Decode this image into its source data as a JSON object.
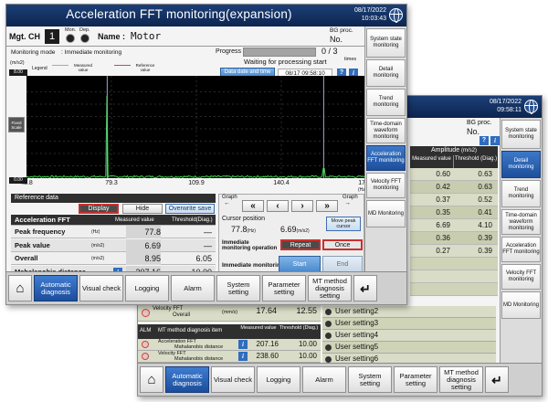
{
  "colors": {
    "title_bg": "#16376b",
    "accent_blue": "#2b64b8",
    "spectrum_line": "#3cd64a",
    "marker_line": "#9aa8d8",
    "reference_line": "#d9414a",
    "olive_row": "#d9dcc6"
  },
  "back": {
    "datetime": [
      "08/17/2022",
      "09:58:11"
    ],
    "bg_proc_label": "BG proc.",
    "no_label": "No.",
    "amplitude_header": "Amplitude",
    "amplitude_unit": "(m/s2)",
    "measured_header": "Measured value",
    "threshold_header": "Threshold (Diag.)",
    "rows": [
      {
        "measured": "0.60",
        "threshold": "0.63"
      },
      {
        "measured": "0.42",
        "threshold": "0.63"
      },
      {
        "measured": "0.37",
        "threshold": "0.52"
      },
      {
        "measured": "0.35",
        "threshold": "0.41"
      },
      {
        "measured": "6.69",
        "threshold": "4.10"
      },
      {
        "measured": "0.36",
        "threshold": "0.39"
      },
      {
        "measured": "0.27",
        "threshold": "0.39"
      }
    ],
    "velocity_row": {
      "label1": "Velocity FFT",
      "label2": "Overall",
      "unit": "(mm/s)",
      "measured": "17.64",
      "threshold": "12.55"
    },
    "mt_table": {
      "al_m": "ALM",
      "item_header": "MT method diagnosis item",
      "measured_header": "Measured value",
      "threshold_header": "Threshold (Diag.)",
      "rows": [
        {
          "label1": "Acceleration FFT",
          "label2": "Mahalanobis distance",
          "measured": "207.16",
          "threshold": "10.00"
        },
        {
          "label1": "Velocity FFT",
          "label2": "Mahalanobis distance",
          "measured": "238.60",
          "threshold": "10.00"
        }
      ]
    },
    "user_settings": [
      "User setting2",
      "User setting3",
      "User setting4",
      "User setting5",
      "User setting6"
    ],
    "side_buttons": [
      "System state monitoring",
      "Detail monitoring",
      "Trend monitoring",
      "Time-domain waveform monitoring",
      "Acceleration FFT monitoring",
      "Velocity FFT monitoring",
      "MD Monitoring"
    ],
    "side_active": 1,
    "bottom_buttons": [
      "Automatic diagnosis",
      "Visual check",
      "Logging",
      "Alarm",
      "System setting",
      "Parameter setting",
      "MT method diagnosis setting"
    ]
  },
  "front": {
    "title": "Acceleration FFT monitoring(expansion)",
    "datetime": [
      "08/17/2022",
      "10:03:43"
    ],
    "mgt_ch_label": "Mgt. CH",
    "mgt_ch_value": "1",
    "mon_label": "Mon.",
    "dep_label": "Dep.",
    "name_label": "Name :",
    "name_value": "Motor",
    "bg_proc_label": "BG proc.",
    "no_label": "No.",
    "monitoring_mode_label": "Monitoring mode",
    "monitoring_mode_value": ": Immediate monitoring",
    "progress_label": "Progress",
    "progress_value": "0",
    "progress_total": "3",
    "times_label": "times",
    "waiting_text": "Waiting for processing start",
    "data_date_label": "Data date and time",
    "data_date_value": "08/17 09:58:10",
    "unit_label": "(m/s2)",
    "legend_label": "Legend",
    "legend_measured": "Measured value",
    "legend_reference": "Reference value",
    "y_top": "8.00",
    "y_bottom": "0.00",
    "hz_label": "(Hz)",
    "fixed_scale": "Fixed Scale",
    "chart_data": {
      "type": "line",
      "x_ticks": [
        "48.8",
        "79.3",
        "109.9",
        "140.4",
        "170.9"
      ],
      "ylim": [
        0,
        8
      ],
      "xlim": [
        48.8,
        170.9
      ],
      "peaks": [
        {
          "x": 77.8,
          "y": 6.69
        },
        {
          "x": 155.6,
          "y": 0.78
        }
      ]
    },
    "reference_title": "Reference data",
    "display_btn": "Display",
    "hide_btn": "Hide",
    "overwrite_btn": "Overwrite save",
    "table_header": {
      "item": "Acceleration FFT",
      "measured": "Measured value",
      "threshold": "Threshold(Diag.)"
    },
    "rows": [
      {
        "label": "Peak frequency",
        "unit": "(Hz)",
        "measured": "77.8",
        "threshold": "—"
      },
      {
        "label": "Peak value",
        "unit": "(m/s2)",
        "measured": "6.69",
        "threshold": "—"
      },
      {
        "label": "Overall",
        "unit": "(m/s2)",
        "measured": "8.95",
        "threshold": "6.05"
      },
      {
        "label": "Mahalanobis distance",
        "unit": "",
        "measured": "207.16",
        "threshold": "10.00"
      }
    ],
    "graph_left_label": "Graph",
    "graph_right_label": "Graph",
    "nav_buttons": [
      "«",
      "‹",
      "›",
      "»"
    ],
    "cursor_position_label": "Cursor position",
    "cursor_freq": "77.8",
    "cursor_freq_unit": "(Hz)",
    "cursor_amp": "6.69",
    "cursor_amp_unit": "(m/s2)",
    "move_peak_btn": "Move peak cursor",
    "imm_operation_label": "Immediate monitoring operation",
    "repeat_btn": "Repeat",
    "once_btn": "Once",
    "imm_monitoring_label": "Immediate monitoring",
    "start_btn": "Start",
    "end_btn": "End",
    "side_buttons": [
      "System state monitoring",
      "Detail monitoring",
      "Trend monitoring",
      "Time-domain waveform monitoring",
      "Acceleration FFT monitoring",
      "Velocity FFT monitoring",
      "MD Monitoring"
    ],
    "side_active": 4,
    "bottom_buttons": [
      "Automatic diagnosis",
      "Visual check",
      "Logging",
      "Alarm",
      "System setting",
      "Parameter setting",
      "MT method diagnosis setting"
    ]
  }
}
